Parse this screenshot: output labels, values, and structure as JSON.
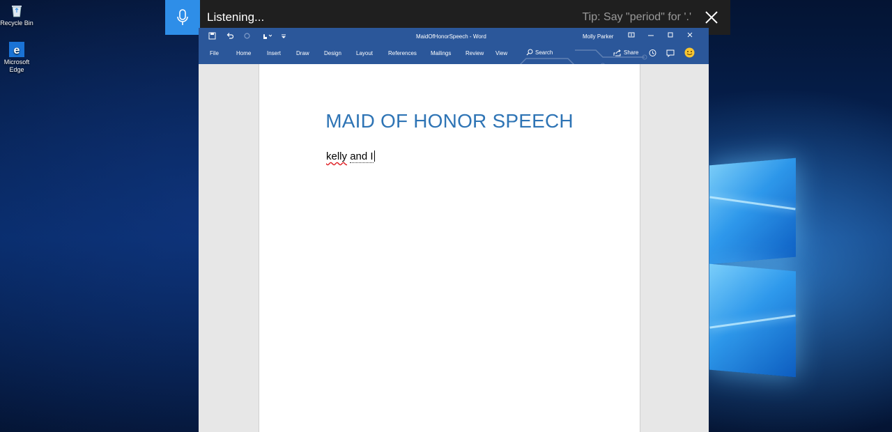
{
  "desktop": {
    "icons": [
      {
        "label": "Recycle Bin",
        "icon": "recycle-bin-icon"
      },
      {
        "label": "Microsoft Edge",
        "icon": "edge-icon"
      }
    ]
  },
  "dictation": {
    "status": "Listening...",
    "tip": "Tip: Say \"period\" for '.'",
    "mic_icon": "microphone-icon",
    "close_icon": "close-icon",
    "accent": "#2e8ee8"
  },
  "word": {
    "doc_title": "MaidOfHonorSpeech  -  Word",
    "user": "Molly Parker",
    "tabs": [
      "File",
      "Home",
      "Insert",
      "Draw",
      "Design",
      "Layout",
      "References",
      "Mailings",
      "Review",
      "View"
    ],
    "search_label": "Search",
    "share_label": "Share",
    "brand_color": "#2b579a",
    "heading": "MAID OF HONOR SPEECH",
    "body_text": [
      "kelly",
      "and I"
    ]
  }
}
